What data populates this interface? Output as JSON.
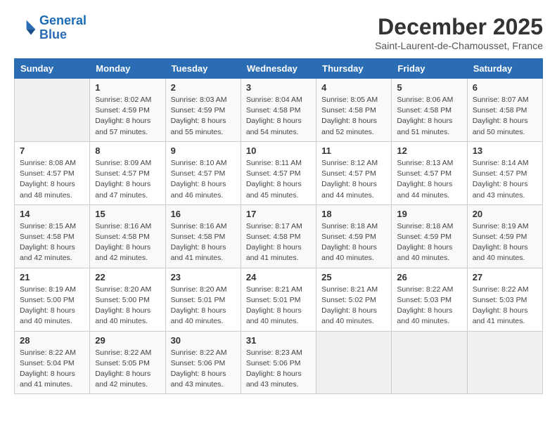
{
  "header": {
    "logo_line1": "General",
    "logo_line2": "Blue",
    "month": "December 2025",
    "location": "Saint-Laurent-de-Chamousset, France"
  },
  "weekdays": [
    "Sunday",
    "Monday",
    "Tuesday",
    "Wednesday",
    "Thursday",
    "Friday",
    "Saturday"
  ],
  "weeks": [
    [
      {
        "day": "",
        "info": ""
      },
      {
        "day": "1",
        "info": "Sunrise: 8:02 AM\nSunset: 4:59 PM\nDaylight: 8 hours\nand 57 minutes."
      },
      {
        "day": "2",
        "info": "Sunrise: 8:03 AM\nSunset: 4:59 PM\nDaylight: 8 hours\nand 55 minutes."
      },
      {
        "day": "3",
        "info": "Sunrise: 8:04 AM\nSunset: 4:58 PM\nDaylight: 8 hours\nand 54 minutes."
      },
      {
        "day": "4",
        "info": "Sunrise: 8:05 AM\nSunset: 4:58 PM\nDaylight: 8 hours\nand 52 minutes."
      },
      {
        "day": "5",
        "info": "Sunrise: 8:06 AM\nSunset: 4:58 PM\nDaylight: 8 hours\nand 51 minutes."
      },
      {
        "day": "6",
        "info": "Sunrise: 8:07 AM\nSunset: 4:58 PM\nDaylight: 8 hours\nand 50 minutes."
      }
    ],
    [
      {
        "day": "7",
        "info": "Sunrise: 8:08 AM\nSunset: 4:57 PM\nDaylight: 8 hours\nand 48 minutes."
      },
      {
        "day": "8",
        "info": "Sunrise: 8:09 AM\nSunset: 4:57 PM\nDaylight: 8 hours\nand 47 minutes."
      },
      {
        "day": "9",
        "info": "Sunrise: 8:10 AM\nSunset: 4:57 PM\nDaylight: 8 hours\nand 46 minutes."
      },
      {
        "day": "10",
        "info": "Sunrise: 8:11 AM\nSunset: 4:57 PM\nDaylight: 8 hours\nand 45 minutes."
      },
      {
        "day": "11",
        "info": "Sunrise: 8:12 AM\nSunset: 4:57 PM\nDaylight: 8 hours\nand 44 minutes."
      },
      {
        "day": "12",
        "info": "Sunrise: 8:13 AM\nSunset: 4:57 PM\nDaylight: 8 hours\nand 44 minutes."
      },
      {
        "day": "13",
        "info": "Sunrise: 8:14 AM\nSunset: 4:57 PM\nDaylight: 8 hours\nand 43 minutes."
      }
    ],
    [
      {
        "day": "14",
        "info": "Sunrise: 8:15 AM\nSunset: 4:58 PM\nDaylight: 8 hours\nand 42 minutes."
      },
      {
        "day": "15",
        "info": "Sunrise: 8:16 AM\nSunset: 4:58 PM\nDaylight: 8 hours\nand 42 minutes."
      },
      {
        "day": "16",
        "info": "Sunrise: 8:16 AM\nSunset: 4:58 PM\nDaylight: 8 hours\nand 41 minutes."
      },
      {
        "day": "17",
        "info": "Sunrise: 8:17 AM\nSunset: 4:58 PM\nDaylight: 8 hours\nand 41 minutes."
      },
      {
        "day": "18",
        "info": "Sunrise: 8:18 AM\nSunset: 4:59 PM\nDaylight: 8 hours\nand 40 minutes."
      },
      {
        "day": "19",
        "info": "Sunrise: 8:18 AM\nSunset: 4:59 PM\nDaylight: 8 hours\nand 40 minutes."
      },
      {
        "day": "20",
        "info": "Sunrise: 8:19 AM\nSunset: 4:59 PM\nDaylight: 8 hours\nand 40 minutes."
      }
    ],
    [
      {
        "day": "21",
        "info": "Sunrise: 8:19 AM\nSunset: 5:00 PM\nDaylight: 8 hours\nand 40 minutes."
      },
      {
        "day": "22",
        "info": "Sunrise: 8:20 AM\nSunset: 5:00 PM\nDaylight: 8 hours\nand 40 minutes."
      },
      {
        "day": "23",
        "info": "Sunrise: 8:20 AM\nSunset: 5:01 PM\nDaylight: 8 hours\nand 40 minutes."
      },
      {
        "day": "24",
        "info": "Sunrise: 8:21 AM\nSunset: 5:01 PM\nDaylight: 8 hours\nand 40 minutes."
      },
      {
        "day": "25",
        "info": "Sunrise: 8:21 AM\nSunset: 5:02 PM\nDaylight: 8 hours\nand 40 minutes."
      },
      {
        "day": "26",
        "info": "Sunrise: 8:22 AM\nSunset: 5:03 PM\nDaylight: 8 hours\nand 40 minutes."
      },
      {
        "day": "27",
        "info": "Sunrise: 8:22 AM\nSunset: 5:03 PM\nDaylight: 8 hours\nand 41 minutes."
      }
    ],
    [
      {
        "day": "28",
        "info": "Sunrise: 8:22 AM\nSunset: 5:04 PM\nDaylight: 8 hours\nand 41 minutes."
      },
      {
        "day": "29",
        "info": "Sunrise: 8:22 AM\nSunset: 5:05 PM\nDaylight: 8 hours\nand 42 minutes."
      },
      {
        "day": "30",
        "info": "Sunrise: 8:22 AM\nSunset: 5:06 PM\nDaylight: 8 hours\nand 43 minutes."
      },
      {
        "day": "31",
        "info": "Sunrise: 8:23 AM\nSunset: 5:06 PM\nDaylight: 8 hours\nand 43 minutes."
      },
      {
        "day": "",
        "info": ""
      },
      {
        "day": "",
        "info": ""
      },
      {
        "day": "",
        "info": ""
      }
    ]
  ]
}
